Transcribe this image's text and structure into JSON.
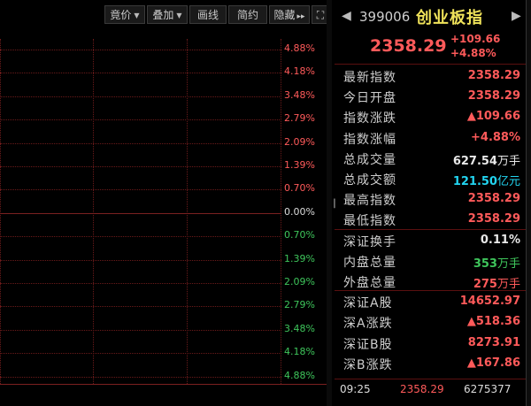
{
  "toolbar": {
    "bid_label": "竟价",
    "overlay_label": "叠加",
    "draw_label": "画线",
    "simple_label": "简约",
    "hide_label": "隐藏",
    "hide_arrows": "▸▸",
    "fullscreen_glyph": "⛶"
  },
  "chart": {
    "pct_labels": [
      "4.88%",
      "4.18%",
      "3.48%",
      "2.79%",
      "2.09%",
      "1.39%",
      "0.70%",
      "0.00%",
      "0.70%",
      "1.39%",
      "2.09%",
      "2.79%",
      "3.48%",
      "4.18%",
      "4.88%"
    ],
    "splitter_glyph": "▕▏"
  },
  "quote": {
    "code": "399006",
    "name": "创业板指",
    "last": "2358.29",
    "change": "+109.66",
    "change_pct": "+4.88%",
    "nav_prev": "◀",
    "nav_next": "▶"
  },
  "stats": [
    {
      "label": "最新指数",
      "value": "2358.29",
      "unit": "",
      "color": "up"
    },
    {
      "label": "今日开盘",
      "value": "2358.29",
      "unit": "",
      "color": "up"
    },
    {
      "label": "指数涨跌",
      "value": "▲109.66",
      "unit": "",
      "color": "up"
    },
    {
      "label": "指数涨幅",
      "value": "+4.88%",
      "unit": "",
      "color": "up"
    },
    {
      "label": "总成交量",
      "value": "627.54",
      "unit": "万手",
      "color": "white"
    },
    {
      "label": "总成交额",
      "value": "121.50",
      "unit": "亿元",
      "color": "cyan"
    },
    {
      "label": "最高指数",
      "value": "2358.29",
      "unit": "",
      "color": "up"
    },
    {
      "label": "最低指数",
      "value": "2358.29",
      "unit": "",
      "color": "up"
    }
  ],
  "stats2": [
    {
      "label": "深证换手",
      "value": "0.11%",
      "unit": "",
      "color": "white"
    },
    {
      "label": "内盘总量",
      "value": "353",
      "unit": "万手",
      "color": "dn"
    },
    {
      "label": "外盘总量",
      "value": "275",
      "unit": "万手",
      "color": "up"
    }
  ],
  "stats3": [
    {
      "label": "深证A股",
      "value": "14652.97",
      "unit": "",
      "color": "up"
    },
    {
      "label": "深A涨跌",
      "value": "▲518.36",
      "unit": "",
      "color": "up"
    },
    {
      "label": "深证B股",
      "value": "8273.91",
      "unit": "",
      "color": "up"
    },
    {
      "label": "深B涨跌",
      "value": "▲167.86",
      "unit": "",
      "color": "up"
    }
  ],
  "tick": {
    "time": "09:25",
    "price": "2358.29",
    "volume": "6275377"
  },
  "colors": {
    "up": "#ff5a5a",
    "down": "#3ec55b",
    "name": "#f0e35a",
    "cyan": "#22d4f0",
    "grid": "#6a1a1a"
  }
}
